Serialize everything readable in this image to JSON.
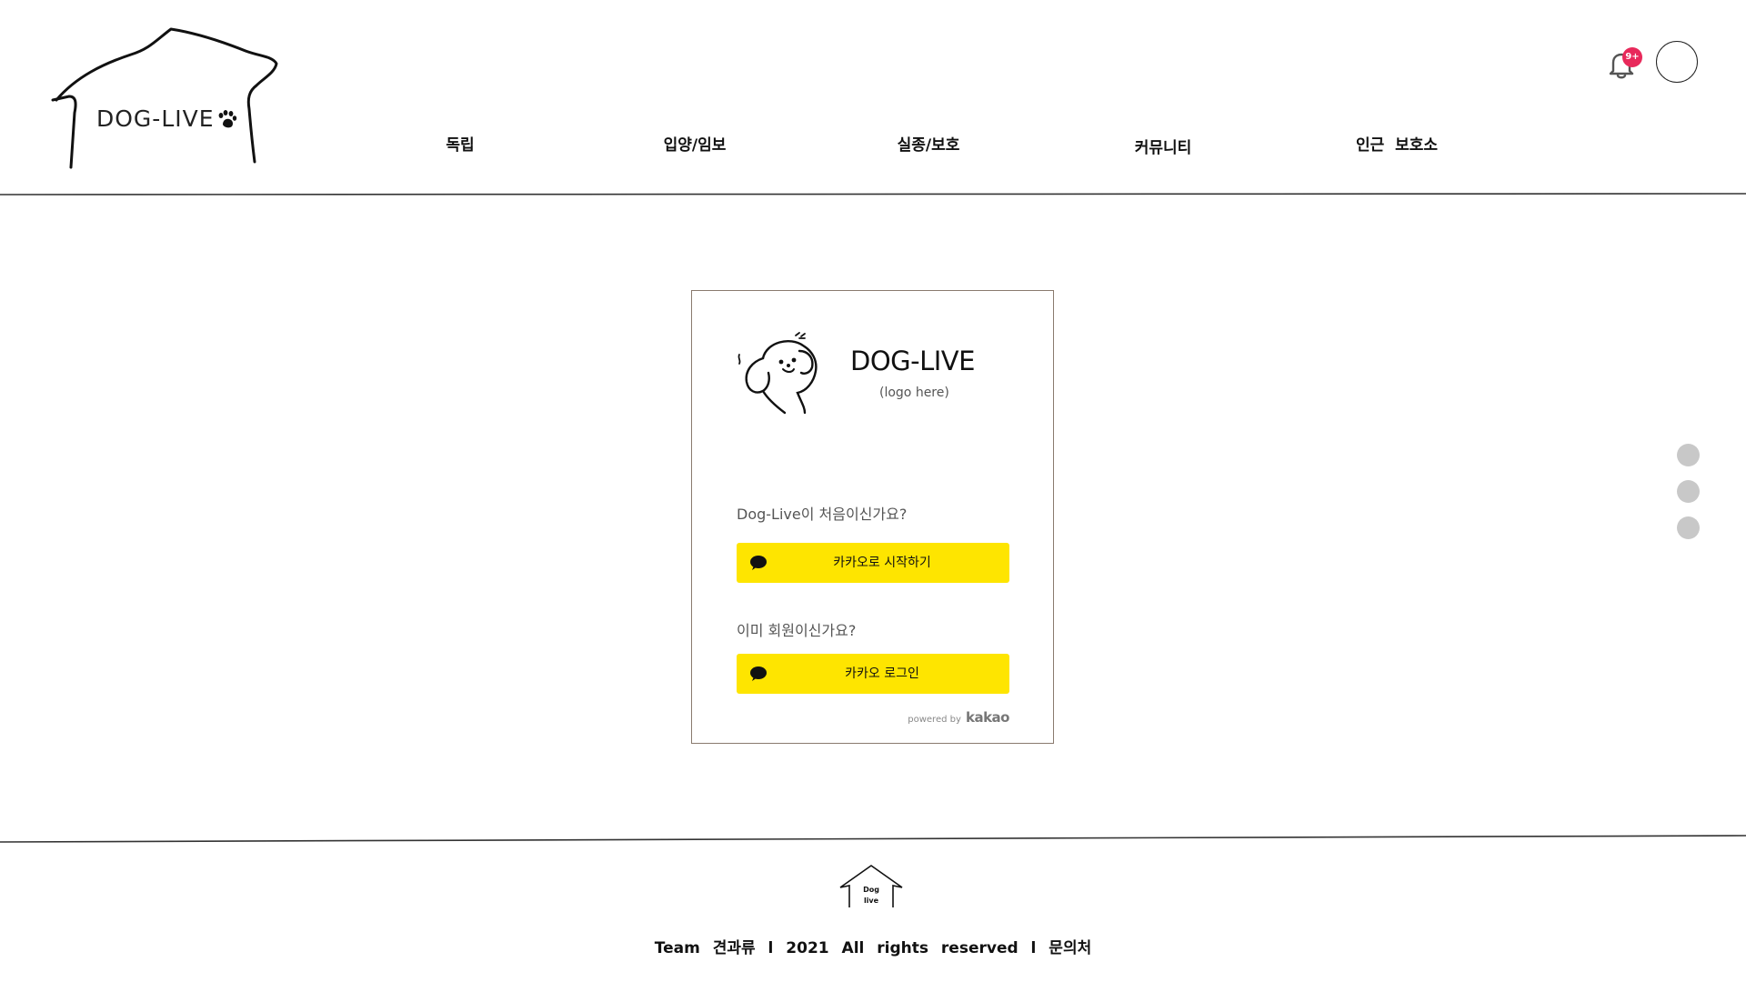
{
  "header": {
    "logo_text": "DOG-LIVE",
    "nav": [
      {
        "label": "독립"
      },
      {
        "label": "입양/임보"
      },
      {
        "label": "실종/보호"
      },
      {
        "label": "커뮤니티"
      },
      {
        "label": "인근  보호소"
      }
    ],
    "notification_badge": "9+",
    "icons": [
      "house-logo-icon",
      "paw-icon",
      "bell-icon",
      "avatar"
    ]
  },
  "login_card": {
    "title": "DOG-LIVE",
    "subtitle": "(logo here)",
    "signup_prompt": "Dog-Live이 처음이신가요?",
    "signup_button": "카카오로 시작하기",
    "login_prompt": "이미 회원이신가요?",
    "login_button": "카카오 로그인",
    "powered_by": "powered by",
    "powered_brand": "kakao",
    "icons": [
      "dog-icon",
      "kakao-bubble-icon"
    ]
  },
  "footer": {
    "logo_line1": "Dog",
    "logo_line2": "live",
    "text": "Team 견과류 l 2021 All rights reserved l 문의처"
  },
  "colors": {
    "kakao_yellow": "#fee500",
    "badge_red": "#e8295b",
    "card_border": "#8a7a6e",
    "dot_gray": "#c8c8c8"
  }
}
